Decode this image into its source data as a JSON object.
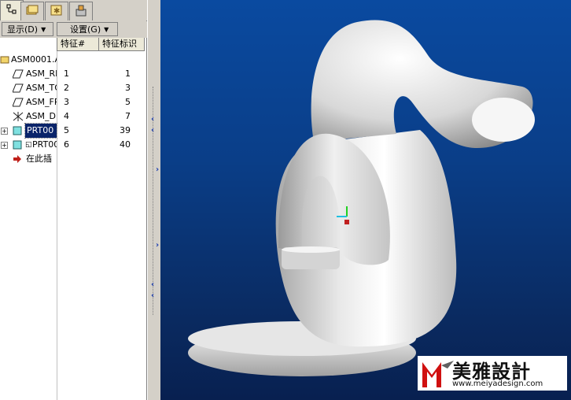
{
  "menu": {
    "display_label": "显示(D)",
    "settings_label": "设置(G)",
    "dropdown_glyph": "▼"
  },
  "columns": {
    "feature_num": "特征#",
    "feature_id": "特征标识"
  },
  "tree": {
    "root": "ASM0001.AS",
    "rows": [
      {
        "name": "ASM_RI",
        "num": "1",
        "id": "1",
        "icon": "datum-plane-icon"
      },
      {
        "name": "ASM_TO",
        "num": "2",
        "id": "3",
        "icon": "datum-plane-icon"
      },
      {
        "name": "ASM_FR",
        "num": "3",
        "id": "5",
        "icon": "datum-plane-icon"
      },
      {
        "name": "ASM_DE",
        "num": "4",
        "id": "7",
        "icon": "coordinate-system-icon"
      },
      {
        "name": "PRT00",
        "num": "5",
        "id": "39",
        "icon": "part-icon",
        "selected": true
      },
      {
        "name": "PRT00",
        "num": "6",
        "id": "40",
        "icon": "part-icon"
      },
      {
        "name": "在此插",
        "num": "",
        "id": "",
        "icon": "insert-here-arrow-icon"
      }
    ],
    "prt6_prefix": "◱",
    "expand_glyph": "+"
  },
  "colors": {
    "selection": "#0a246a",
    "viewport_top": "#0a4aa0",
    "viewport_bottom": "#082050",
    "arrows": "#1a3cb0",
    "insert_arrow": "#c0201a",
    "watermark_red": "#d01010"
  },
  "watermark": {
    "chinese": "美雅設計",
    "url": "www.meiyadesign.com"
  }
}
